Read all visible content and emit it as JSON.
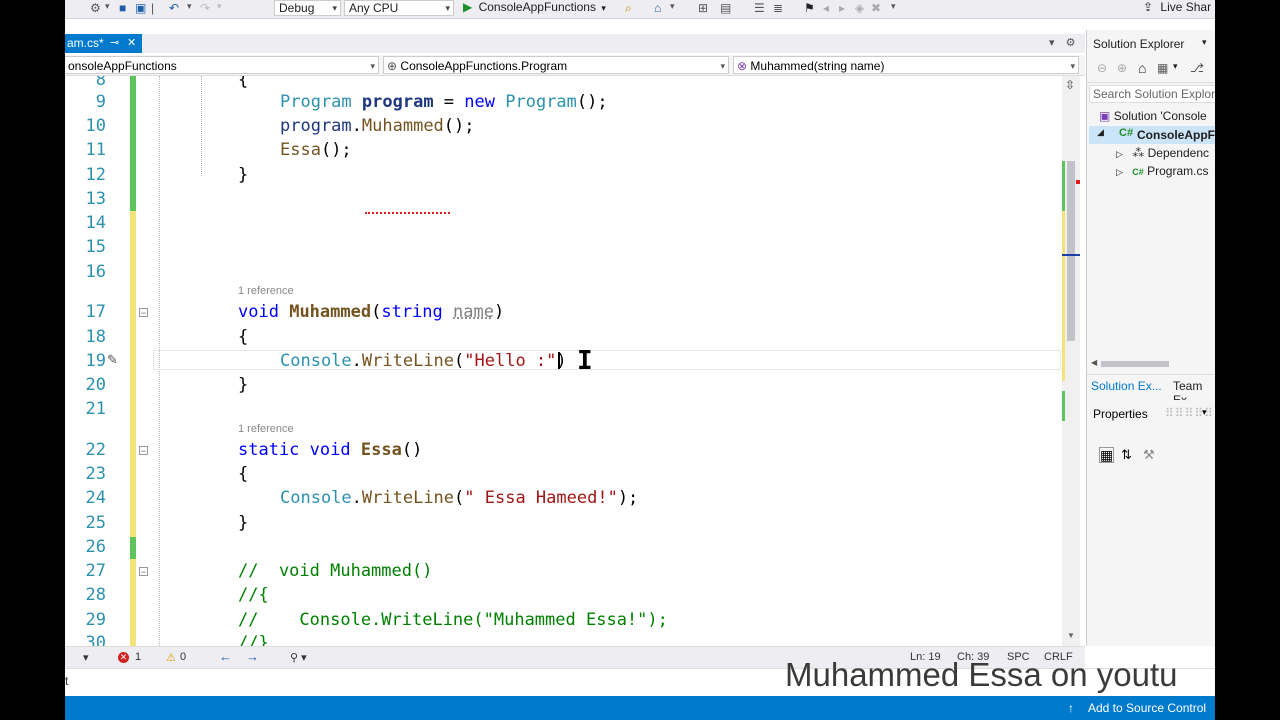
{
  "toolbar": {
    "config": "Debug",
    "platform": "Any CPU",
    "run_target": "ConsoleAppFunctions",
    "live_share": "Live Shar"
  },
  "tab": {
    "label": "am.cs*",
    "close": "✕"
  },
  "navbar": {
    "project": "onsoleAppFunctions",
    "class": "ConsoleAppFunctions.Program",
    "member": "Muhammed(string name)"
  },
  "editor": {
    "line_numbers": [
      "8",
      "9",
      "10",
      "11",
      "12",
      "13",
      "14",
      "15",
      "16",
      "17",
      "18",
      "19",
      "20",
      "21",
      "22",
      "23",
      "24",
      "25",
      "26",
      "27",
      "28",
      "29",
      "30"
    ],
    "reference_label": "1 reference",
    "code": {
      "l8": "{",
      "l9_type": "Program",
      "l9_var": "program",
      "l9_eq": " = ",
      "l9_new": "new",
      "l9_type2": "Program",
      "l9_end": "();",
      "l10_var": "program",
      "l10_dot": ".",
      "l10_call": "Muhammed",
      "l10_end": "();",
      "l11_call": "Essa",
      "l11_end": "();",
      "l12": "}",
      "l17_void": "void",
      "l17_name": "Muhammed",
      "l17_paren": "(",
      "l17_string": "string",
      "l17_param": "name",
      "l17_close": ")",
      "l18": "{",
      "l19_console": "Console",
      "l19_dot": ".",
      "l19_write": "WriteLine",
      "l19_open": "(",
      "l19_str": "\"Hello :\"",
      "l19_close": ")",
      "l20": "}",
      "l22_static": "static",
      "l22_void": "void",
      "l22_name": "Essa",
      "l22_paren": "()",
      "l23": "{",
      "l24_console": "Console",
      "l24_dot": ".",
      "l24_write": "WriteLine",
      "l24_open": "(",
      "l24_str": "\" Essa Hameed!\"",
      "l24_close": ");",
      "l25": "}",
      "l27": "//  void Muhammed()",
      "l28": "//{",
      "l29": "//    Console.WriteLine(\"Muhammed Essa!\");",
      "l30": "//}"
    }
  },
  "status": {
    "zoom_arrow": "▾",
    "errors": "1",
    "warnings": "0",
    "ln": "Ln: 19",
    "ch": "Ch: 39",
    "spc": "SPC",
    "crlf": "CRLF"
  },
  "output_strip": {
    "label": "t"
  },
  "watermark": "Muhammed Essa on youtu",
  "bottom_bar": {
    "source_control": "Add to Source Control"
  },
  "solution_explorer": {
    "title": "Solution Explorer",
    "search_placeholder": "Search Solution Explor",
    "solution": "Solution 'Console",
    "project": "ConsoleAppF",
    "dependencies": "Dependenc",
    "program": "Program.cs",
    "tab1": "Solution Ex...",
    "tab2": "Team Ex"
  },
  "properties": {
    "title": "Properties"
  },
  "colors": {
    "accent": "#007acc",
    "keyword": "#0000ff",
    "type": "#2b91af",
    "string": "#a31515",
    "comment": "#008000",
    "method": "#74531f"
  }
}
